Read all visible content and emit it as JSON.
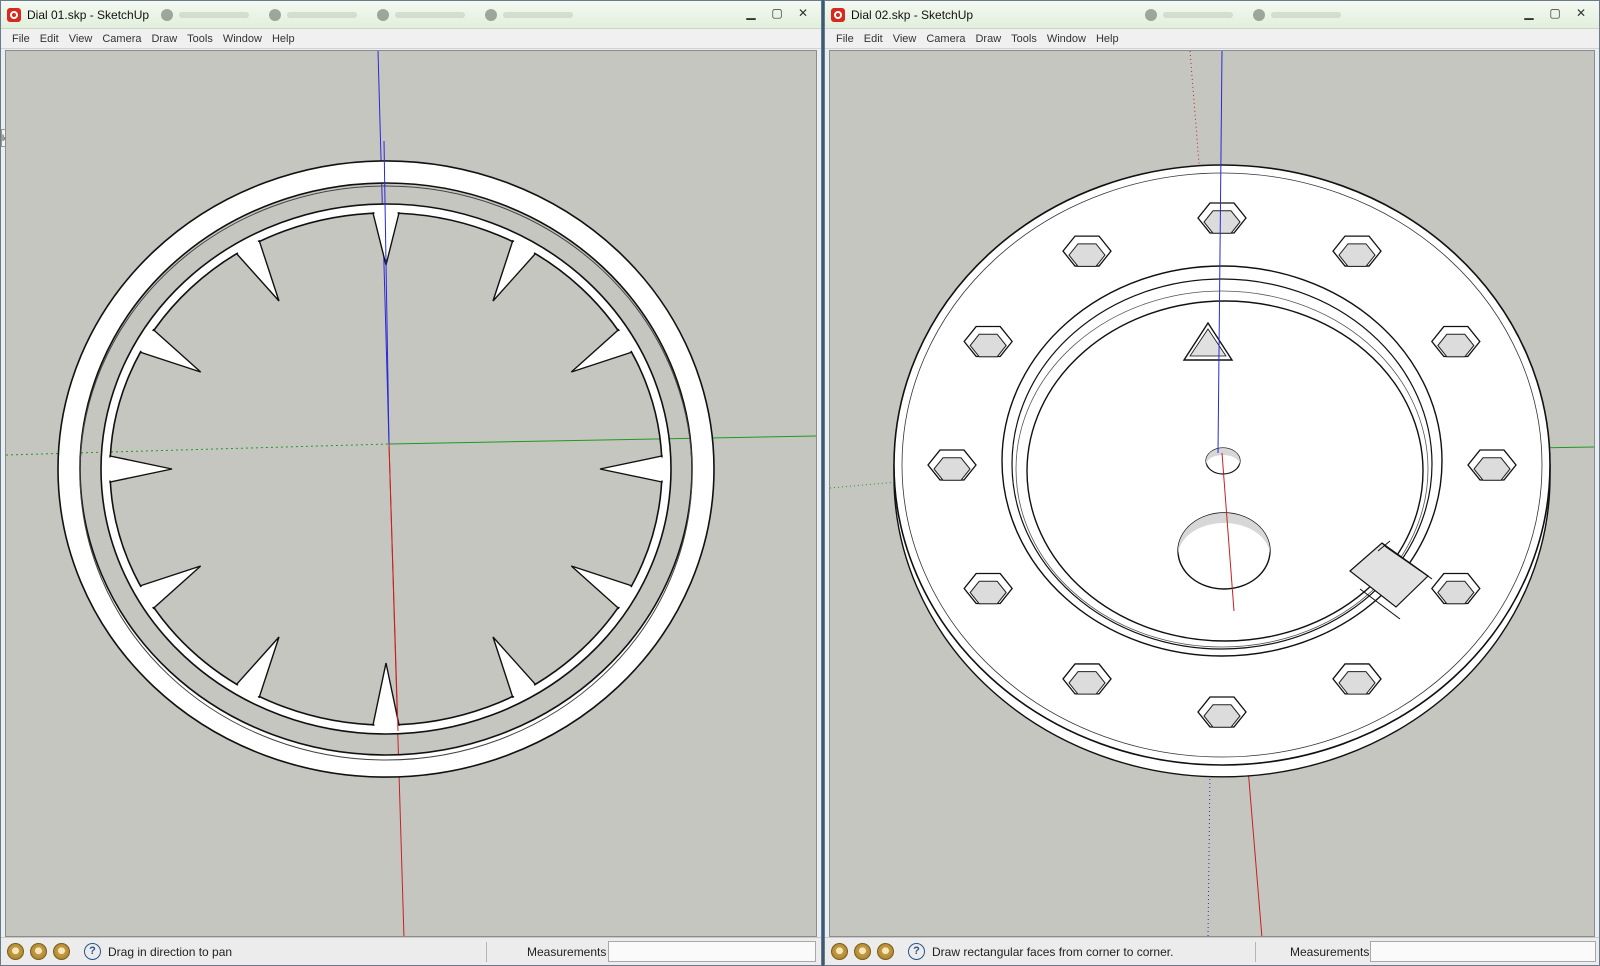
{
  "colors": {
    "viewport_bg": "#c6c6c1",
    "axis_blue": "#2a2ad6",
    "axis_red": "#c82020",
    "axis_green": "#1e9a1e",
    "face": "#ffffff",
    "edge": "#111111"
  },
  "windows": [
    {
      "title": "Dial 01.skp - SketchUp",
      "menu": [
        "File",
        "Edit",
        "View",
        "Camera",
        "Draw",
        "Tools",
        "Window",
        "Help"
      ],
      "status_message": "Drag in direction to pan",
      "measurements_label": "Measurements",
      "side_tab_label": "le"
    },
    {
      "title": "Dial 02.skp - SketchUp",
      "menu": [
        "File",
        "Edit",
        "View",
        "Camera",
        "Draw",
        "Tools",
        "Window",
        "Help"
      ],
      "status_message": "Draw rectangular faces from corner to corner.",
      "measurements_label": "Measurements"
    }
  ],
  "icons": {
    "app": "sketchup-logo-icon",
    "minimize": "minimize-icon",
    "maximize": "maximize-icon",
    "close": "close-icon",
    "status": [
      "geo-location-icon",
      "credits-icon",
      "user-sign-in-icon"
    ],
    "help": "help-icon"
  }
}
